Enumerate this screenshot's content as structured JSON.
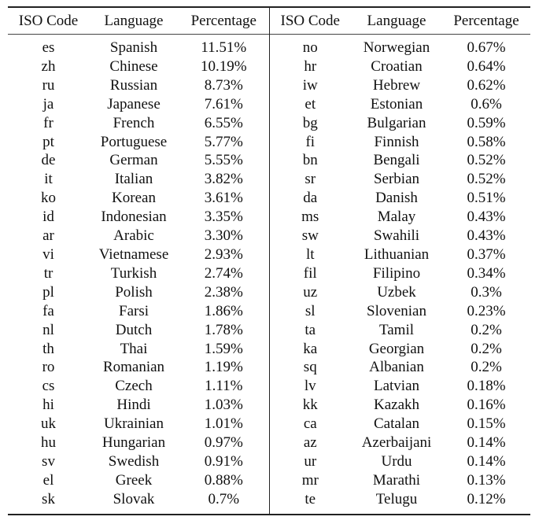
{
  "table": {
    "headers": [
      "ISO Code",
      "Language",
      "Percentage",
      "ISO Code",
      "Language",
      "Percentage"
    ],
    "left": [
      {
        "code": "es",
        "language": "Spanish",
        "percentage": "11.51%"
      },
      {
        "code": "zh",
        "language": "Chinese",
        "percentage": "10.19%"
      },
      {
        "code": "ru",
        "language": "Russian",
        "percentage": "8.73%"
      },
      {
        "code": "ja",
        "language": "Japanese",
        "percentage": "7.61%"
      },
      {
        "code": "fr",
        "language": "French",
        "percentage": "6.55%"
      },
      {
        "code": "pt",
        "language": "Portuguese",
        "percentage": "5.77%"
      },
      {
        "code": "de",
        "language": "German",
        "percentage": "5.55%"
      },
      {
        "code": "it",
        "language": "Italian",
        "percentage": "3.82%"
      },
      {
        "code": "ko",
        "language": "Korean",
        "percentage": "3.61%"
      },
      {
        "code": "id",
        "language": "Indonesian",
        "percentage": "3.35%"
      },
      {
        "code": "ar",
        "language": "Arabic",
        "percentage": "3.30%"
      },
      {
        "code": "vi",
        "language": "Vietnamese",
        "percentage": "2.93%"
      },
      {
        "code": "tr",
        "language": "Turkish",
        "percentage": "2.74%"
      },
      {
        "code": "pl",
        "language": "Polish",
        "percentage": "2.38%"
      },
      {
        "code": "fa",
        "language": "Farsi",
        "percentage": "1.86%"
      },
      {
        "code": "nl",
        "language": "Dutch",
        "percentage": "1.78%"
      },
      {
        "code": "th",
        "language": "Thai",
        "percentage": "1.59%"
      },
      {
        "code": "ro",
        "language": "Romanian",
        "percentage": "1.19%"
      },
      {
        "code": "cs",
        "language": "Czech",
        "percentage": "1.11%"
      },
      {
        "code": "hi",
        "language": "Hindi",
        "percentage": "1.03%"
      },
      {
        "code": "uk",
        "language": "Ukrainian",
        "percentage": "1.01%"
      },
      {
        "code": "hu",
        "language": "Hungarian",
        "percentage": "0.97%"
      },
      {
        "code": "sv",
        "language": "Swedish",
        "percentage": "0.91%"
      },
      {
        "code": "el",
        "language": "Greek",
        "percentage": "0.88%"
      },
      {
        "code": "sk",
        "language": "Slovak",
        "percentage": "0.7%"
      }
    ],
    "right": [
      {
        "code": "no",
        "language": "Norwegian",
        "percentage": "0.67%"
      },
      {
        "code": "hr",
        "language": "Croatian",
        "percentage": "0.64%"
      },
      {
        "code": "iw",
        "language": "Hebrew",
        "percentage": "0.62%"
      },
      {
        "code": "et",
        "language": "Estonian",
        "percentage": "0.6%"
      },
      {
        "code": "bg",
        "language": "Bulgarian",
        "percentage": "0.59%"
      },
      {
        "code": "fi",
        "language": "Finnish",
        "percentage": "0.58%"
      },
      {
        "code": "bn",
        "language": "Bengali",
        "percentage": "0.52%"
      },
      {
        "code": "sr",
        "language": "Serbian",
        "percentage": "0.52%"
      },
      {
        "code": "da",
        "language": "Danish",
        "percentage": "0.51%"
      },
      {
        "code": "ms",
        "language": "Malay",
        "percentage": "0.43%"
      },
      {
        "code": "sw",
        "language": "Swahili",
        "percentage": "0.43%"
      },
      {
        "code": "lt",
        "language": "Lithuanian",
        "percentage": "0.37%"
      },
      {
        "code": "fil",
        "language": "Filipino",
        "percentage": "0.34%"
      },
      {
        "code": "uz",
        "language": "Uzbek",
        "percentage": "0.3%"
      },
      {
        "code": "sl",
        "language": "Slovenian",
        "percentage": "0.23%"
      },
      {
        "code": "ta",
        "language": "Tamil",
        "percentage": "0.2%"
      },
      {
        "code": "ka",
        "language": "Georgian",
        "percentage": "0.2%"
      },
      {
        "code": "sq",
        "language": "Albanian",
        "percentage": "0.2%"
      },
      {
        "code": "lv",
        "language": "Latvian",
        "percentage": "0.18%"
      },
      {
        "code": "kk",
        "language": "Kazakh",
        "percentage": "0.16%"
      },
      {
        "code": "ca",
        "language": "Catalan",
        "percentage": "0.15%"
      },
      {
        "code": "az",
        "language": "Azerbaijani",
        "percentage": "0.14%"
      },
      {
        "code": "ur",
        "language": "Urdu",
        "percentage": "0.14%"
      },
      {
        "code": "mr",
        "language": "Marathi",
        "percentage": "0.13%"
      },
      {
        "code": "te",
        "language": "Telugu",
        "percentage": "0.12%"
      }
    ]
  }
}
